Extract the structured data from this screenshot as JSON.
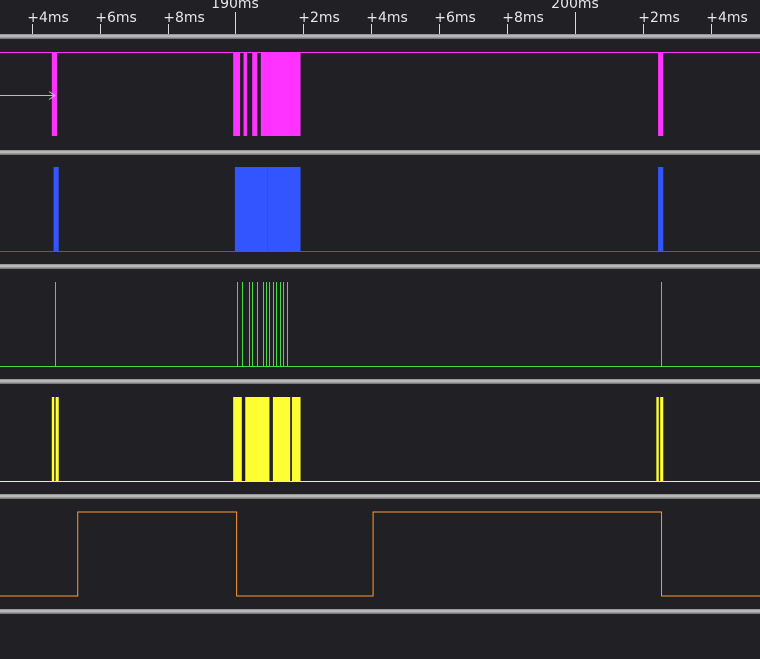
{
  "ruler": {
    "ticks": [
      {
        "label": "+4ms",
        "major": false
      },
      {
        "label": "+6ms",
        "major": false
      },
      {
        "label": "+8ms",
        "major": false
      },
      {
        "label": "190ms",
        "major": true
      },
      {
        "label": "+2ms",
        "major": false
      },
      {
        "label": "+4ms",
        "major": false
      },
      {
        "label": "+6ms",
        "major": false
      },
      {
        "label": "+8ms",
        "major": false
      },
      {
        "label": "200ms",
        "major": true
      },
      {
        "label": "+2ms",
        "major": false
      },
      {
        "label": "+4ms",
        "major": false
      }
    ]
  },
  "time_range_ms": [
    183.15,
    205.15
  ],
  "channels": [
    {
      "color": "#ff33ff",
      "baseline": "high",
      "pulses_ms": [
        [
          184.65,
          184.8
        ],
        [
          189.9,
          190.1
        ],
        [
          190.2,
          190.3
        ],
        [
          190.45,
          190.6
        ],
        [
          190.7,
          190.95
        ],
        [
          190.95,
          191.85
        ],
        [
          202.2,
          202.35
        ]
      ],
      "has_marker_arrow": true
    },
    {
      "color": "#3355ff",
      "baseline": "low",
      "pulses_ms": [
        [
          184.7,
          184.85
        ],
        [
          189.95,
          190.9
        ],
        [
          190.9,
          191.85
        ],
        [
          202.2,
          202.35
        ]
      ],
      "has_marker_arrow": false
    },
    {
      "color": "#44dd44",
      "baseline": "low",
      "lines_ms": [
        184.75,
        190.0,
        190.15,
        190.35,
        190.45,
        190.6,
        190.75,
        190.85,
        190.95,
        191.05,
        191.15,
        191.25,
        191.35,
        191.45,
        202.27
      ],
      "has_marker_arrow": false
    },
    {
      "color": "#ffff33",
      "baseline": "low",
      "pulses_ms": [
        [
          184.65,
          184.72
        ],
        [
          184.76,
          184.85
        ],
        [
          189.9,
          190.15
        ],
        [
          190.25,
          190.95
        ],
        [
          191.05,
          191.55
        ],
        [
          191.6,
          191.85
        ],
        [
          202.15,
          202.22
        ],
        [
          202.26,
          202.35
        ]
      ],
      "has_marker_arrow": false
    },
    {
      "color": "#ff9933",
      "type": "square",
      "levels": [
        {
          "t": 183.15,
          "v": 0
        },
        {
          "t": 185.4,
          "v": 1
        },
        {
          "t": 190.0,
          "v": 0
        },
        {
          "t": 193.95,
          "v": 1
        },
        {
          "t": 202.3,
          "v": 0
        }
      ],
      "has_marker_arrow": false
    }
  ]
}
